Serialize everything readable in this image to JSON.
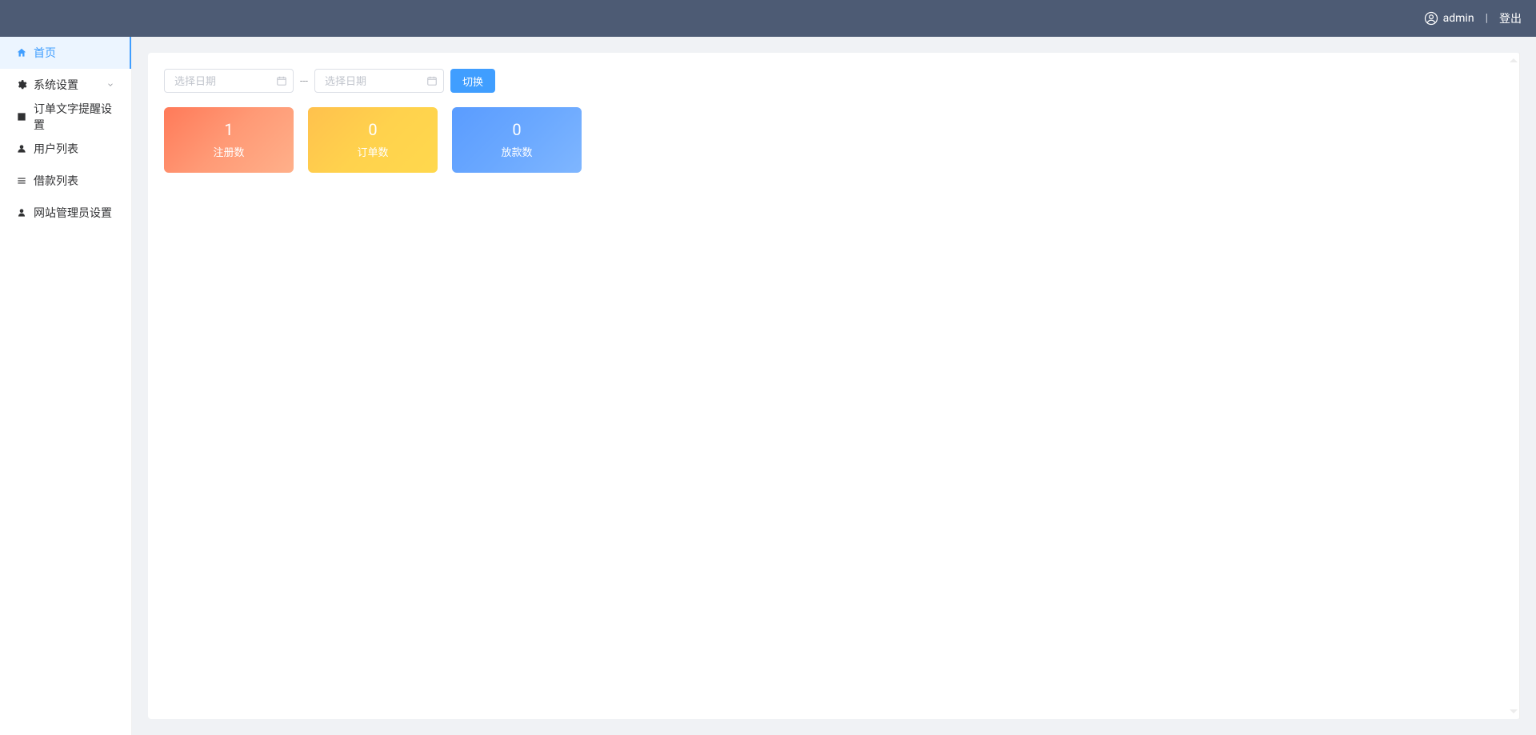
{
  "header": {
    "username": "admin",
    "logout_label": "登出",
    "divider": "|"
  },
  "sidebar": {
    "items": [
      {
        "label": "首页",
        "icon": "home-icon",
        "active": true,
        "hasCaret": false
      },
      {
        "label": "系统设置",
        "icon": "gear-icon",
        "active": false,
        "hasCaret": true
      },
      {
        "label": "订单文字提醒设置",
        "icon": "note-icon",
        "active": false,
        "hasCaret": false
      },
      {
        "label": "用户列表",
        "icon": "users-icon",
        "active": false,
        "hasCaret": false
      },
      {
        "label": "借款列表",
        "icon": "list-icon",
        "active": false,
        "hasCaret": false
      },
      {
        "label": "网站管理员设置",
        "icon": "person-icon",
        "active": false,
        "hasCaret": false
      }
    ]
  },
  "filter": {
    "start_placeholder": "选择日期",
    "end_placeholder": "选择日期",
    "range_sep": "---",
    "toggle_label": "切换"
  },
  "cards": [
    {
      "value": "1",
      "label": "注册数",
      "theme": "orange"
    },
    {
      "value": "0",
      "label": "订单数",
      "theme": "yellow"
    },
    {
      "value": "0",
      "label": "放款数",
      "theme": "blue"
    }
  ]
}
